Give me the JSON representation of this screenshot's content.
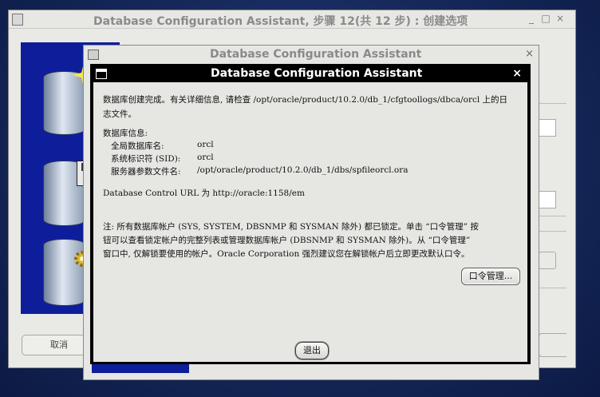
{
  "background_window": {
    "title": "Database Configuration Assistant, 步骤 12(共 12 步) :  创建选项",
    "minimize_glyph": "_",
    "maximize_glyph": "□",
    "close_glyph": "×",
    "cancel_label": "取消"
  },
  "middle_dialog": {
    "title": "Database Configuration Assistant",
    "close_glyph": "×"
  },
  "dialog": {
    "title": "Database Configuration Assistant",
    "close_glyph": "×",
    "msg_line1": "数据库创建完成。有关详细信息, 请检查 /opt/oracle/product/10.2.0/db_1/cfgtoollogs/dbca/orcl 上的日",
    "msg_line2": "志文件。",
    "info_header": "数据库信息:",
    "global_db_name_label": "全局数据库名:",
    "global_db_name_value": "orcl",
    "sid_label": "系统标识符 (SID):",
    "sid_value": "orcl",
    "spfile_label": "服务器参数文件名:",
    "spfile_value": "/opt/oracle/product/10.2.0/db_1/dbs/spfileorcl.ora",
    "db_control_url": "Database Control URL 为 http://oracle:1158/em",
    "note_line1": "注: 所有数据库帐户 (SYS, SYSTEM, DBSNMP 和 SYSMAN 除外) 都已锁定。单击 “口令管理” 按",
    "note_line2": "钮可以查看锁定帐户的完整列表或管理数据库帐户 (DBSNMP 和 SYSMAN 除外)。从 “口令管理”",
    "note_line3": "窗口中, 仅解锁要使用的帐户。Oracle Corporation 强烈建议您在解锁帐户后立即更改默认口令。",
    "password_button_label": "口令管理...",
    "exit_button_label": "退出"
  },
  "colors": {
    "desktop": "#16285a",
    "wizard_side_panel": "#0e1e9a",
    "active_titlebar": "#000000",
    "dialog_body": "#e6e6e3"
  },
  "icons": [
    "window-menu-icon",
    "close-icon",
    "database-cylinder-icon",
    "floppy-disk-icon",
    "gear-icon"
  ]
}
